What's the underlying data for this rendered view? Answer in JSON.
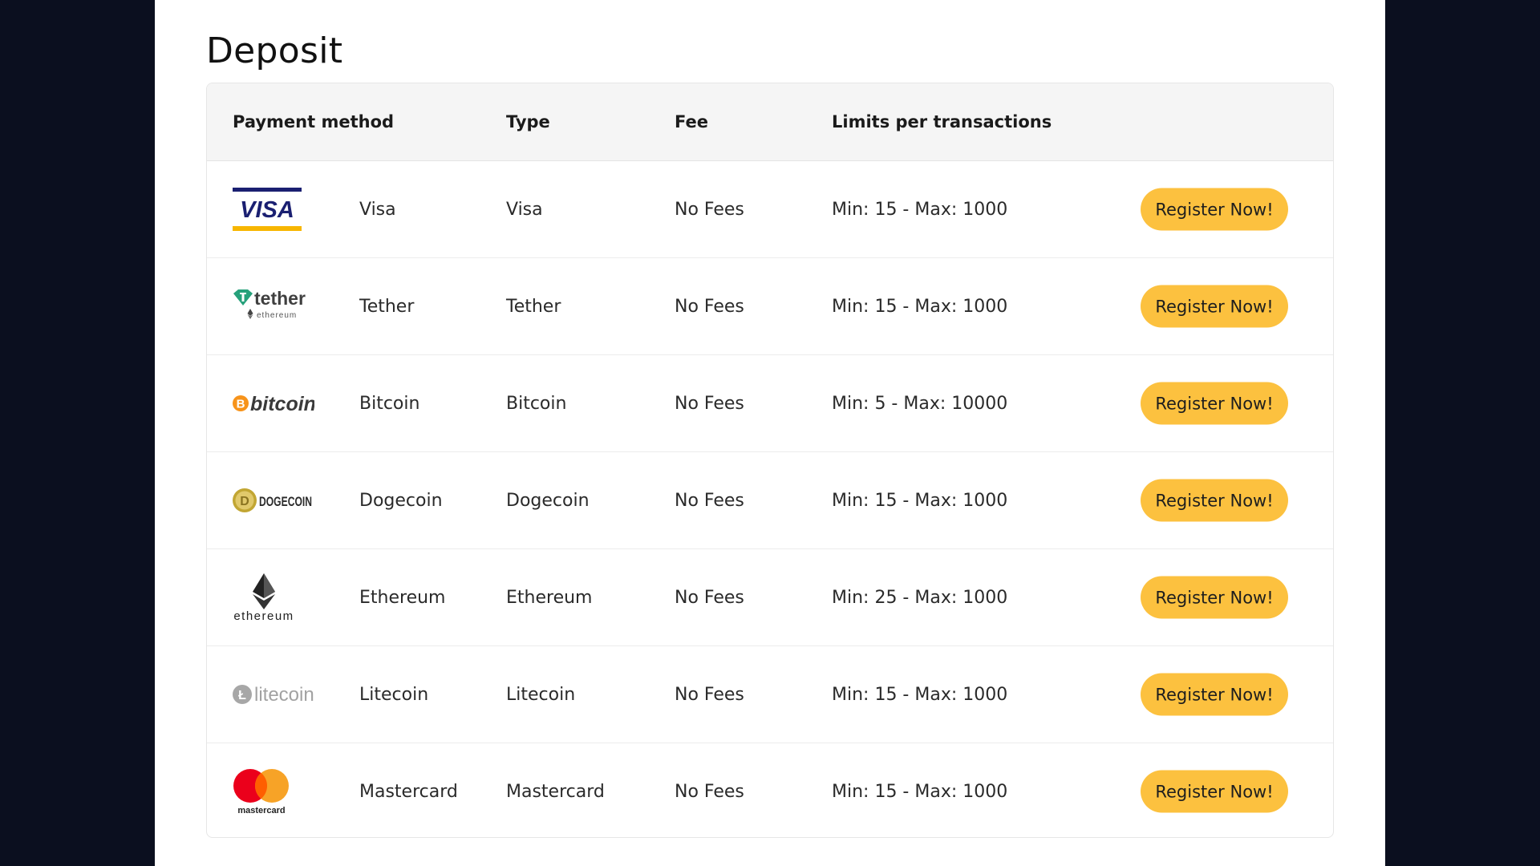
{
  "title": "Deposit",
  "columns": {
    "payment_method": "Payment method",
    "type": "Type",
    "fee": "Fee",
    "limits": "Limits per transactions"
  },
  "rows": [
    {
      "logo": "VISA",
      "name": "Visa",
      "type": "Visa",
      "fee": "No Fees",
      "limits": "Min: 15 - Max: 1000",
      "button": "Register Now!"
    },
    {
      "logo": "tether",
      "logo_sub": "ethereum",
      "name": "Tether",
      "type": "Tether",
      "fee": "No Fees",
      "limits": "Min: 15 - Max: 1000",
      "button": "Register Now!"
    },
    {
      "logo": "bitcoin",
      "name": "Bitcoin",
      "type": "Bitcoin",
      "fee": "No Fees",
      "limits": "Min: 5 - Max: 10000",
      "button": "Register Now!"
    },
    {
      "logo": "DOGECOIN",
      "name": "Dogecoin",
      "type": "Dogecoin",
      "fee": "No Fees",
      "limits": "Min: 15 - Max: 1000",
      "button": "Register Now!"
    },
    {
      "logo": "ethereum",
      "name": "Ethereum",
      "type": "Ethereum",
      "fee": "No Fees",
      "limits": "Min: 25 - Max: 1000",
      "button": "Register Now!"
    },
    {
      "logo": "litecoin",
      "name": "Litecoin",
      "type": "Litecoin",
      "fee": "No Fees",
      "limits": "Min: 15 - Max: 1000",
      "button": "Register Now!"
    },
    {
      "logo": "mastercard",
      "name": "Mastercard",
      "type": "Mastercard",
      "fee": "No Fees",
      "limits": "Min: 15 - Max: 1000",
      "button": "Register Now!"
    }
  ],
  "colors": {
    "background": "#0b0f1f",
    "panel": "#ffffff",
    "header_bg": "#f5f5f5",
    "button": "#fcc13f",
    "visa_blue": "#1a1f71",
    "visa_gold": "#f7b600",
    "tether_green": "#26a17b",
    "bitcoin_orange": "#f7931a",
    "dogecoin_gold": "#c2a633",
    "mastercard_red": "#eb001b",
    "mastercard_orange": "#f79e1b"
  }
}
